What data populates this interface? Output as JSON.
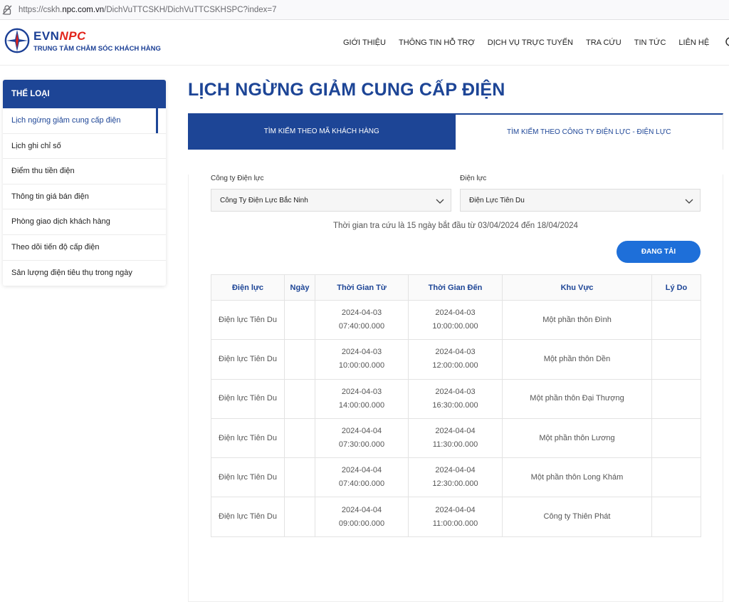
{
  "browser": {
    "url_prefix": "https://cskh.",
    "url_domain": "npc.com.vn",
    "url_path": "/DichVuTTCSKH/DichVuTTCSKHSPC?index=7"
  },
  "header": {
    "brand_evn": "EVN",
    "brand_npc": "NPC",
    "brand_sub": "TRUNG TÂM CHĂM SÓC KHÁCH HÀNG",
    "nav": [
      "GIỚI THIỆU",
      "THÔNG TIN HỖ TRỢ",
      "DỊCH VỤ TRỰC TUYẾN",
      "TRA CỨU",
      "TIN TỨC",
      "LIÊN HỆ"
    ],
    "icons": [
      "search-icon",
      "user-icon"
    ]
  },
  "sidebar": {
    "title": "THỂ LOẠI",
    "items": [
      "Lịch ngừng giảm cung cấp điện",
      "Lịch ghi chỉ số",
      "Điểm thu tiền điện",
      "Thông tin giá bán điện",
      "Phòng giao dịch khách hàng",
      "Theo dõi tiến độ cấp điện",
      "Sản lượng điện tiêu thụ trong ngày"
    ]
  },
  "main": {
    "title": "LỊCH NGỪNG GIẢM CUNG CẤP ĐIỆN",
    "tabs": [
      "TÌM KIẾM THEO MÃ KHÁCH HÀNG",
      "TÌM KIẾM THEO CÔNG TY ĐIỆN LỰC - ĐIỆN LỰC"
    ],
    "company_label": "Công ty Điện lực",
    "company_value": "Công Ty Điện Lực Bắc Ninh",
    "branch_label": "Điện lực",
    "branch_value": "Điện Lực Tiên Du",
    "hint": "Thời gian tra cứu là 15 ngày bắt đầu từ 03/04/2024 đến 18/04/2024",
    "button": "ĐANG TẢI",
    "columns": [
      "Điện lực",
      "Ngày",
      "Thời Gian Từ",
      "Thời Gian Đến",
      "Khu Vực",
      "Lý Do"
    ],
    "rows": [
      [
        "Điện lực Tiên Du",
        "",
        "2024-04-03",
        "07:40:00.000",
        "2024-04-03",
        "10:00:00.000",
        "Một phần thôn Đình",
        ""
      ],
      [
        "Điện lực Tiên Du",
        "",
        "2024-04-03",
        "10:00:00.000",
        "2024-04-03",
        "12:00:00.000",
        "Một phần thôn Dền",
        ""
      ],
      [
        "Điện lực Tiên Du",
        "",
        "2024-04-03",
        "14:00:00.000",
        "2024-04-03",
        "16:30:00.000",
        "Một phần thôn Đại Thượng",
        ""
      ],
      [
        "Điện lực Tiên Du",
        "",
        "2024-04-04",
        "07:30:00.000",
        "2024-04-04",
        "11:30:00.000",
        "Một phần thôn Lương",
        ""
      ],
      [
        "Điện lực Tiên Du",
        "",
        "2024-04-04",
        "07:40:00.000",
        "2024-04-04",
        "12:30:00.000",
        "Một phần thôn Long Khám",
        ""
      ],
      [
        "Điện lực Tiên Du",
        "",
        "2024-04-04",
        "09:00:00.000",
        "2024-04-04",
        "11:00:00.000",
        "Công ty Thiên Phát",
        ""
      ]
    ]
  }
}
